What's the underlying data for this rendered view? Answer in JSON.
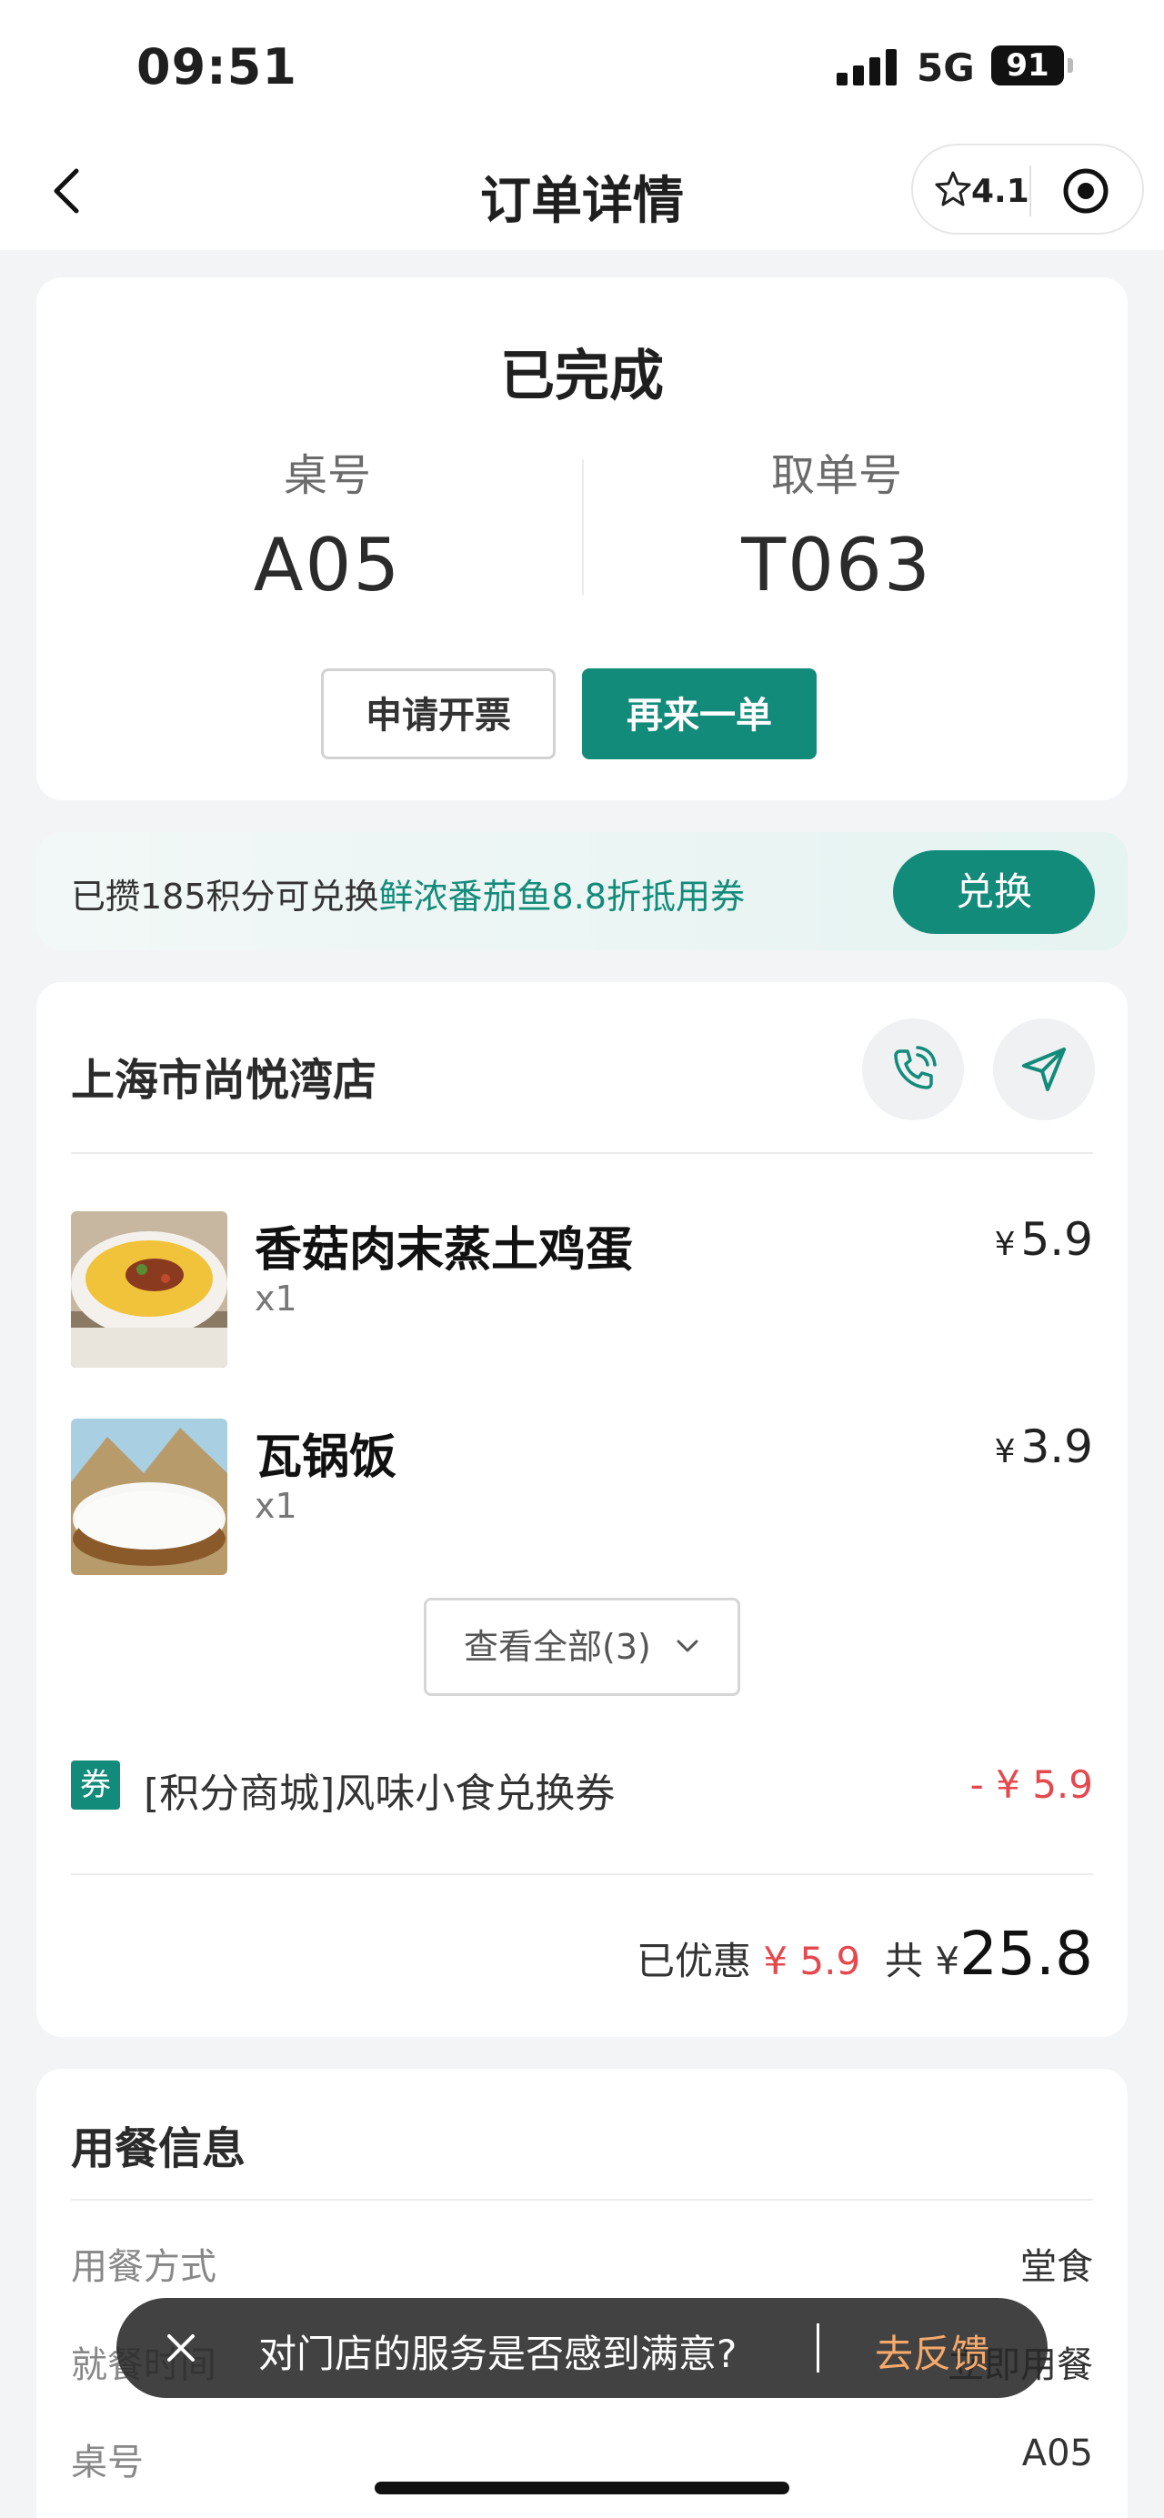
{
  "status_bar": {
    "time": "09:51",
    "network": "5G",
    "battery": "91"
  },
  "nav": {
    "title": "订单详情",
    "rating": "4.1"
  },
  "order_status": {
    "title": "已完成",
    "table_label": "桌号",
    "table_value": "A05",
    "pickup_label": "取单号",
    "pickup_value": "T063",
    "invoice_button": "申请开票",
    "reorder_button": "再来一单"
  },
  "points": {
    "text": "已攒185积分可兑换",
    "coupon": "鲜浓番茄鱼8.8折抵用券",
    "button": "兑换"
  },
  "store": {
    "name": "上海市尚悦湾店"
  },
  "items": [
    {
      "name": "香菇肉末蒸土鸡蛋",
      "qty": "x1",
      "currency": "¥",
      "price": "5.9"
    },
    {
      "name": "瓦锅饭",
      "qty": "x1",
      "currency": "¥",
      "price": "3.9"
    }
  ],
  "view_all": "查看全部(3)",
  "coupon": {
    "tag": "券",
    "name": "[积分商城]风味小食兑换券",
    "amount": "- ¥ 5.9"
  },
  "totals": {
    "discount_label": "已优惠",
    "discount_value": "¥ 5.9",
    "total_label": "共",
    "currency": "¥",
    "total_value": "25.8"
  },
  "dining": {
    "title": "用餐信息",
    "rows": [
      {
        "key": "用餐方式",
        "value": "堂食"
      },
      {
        "key": "就餐时间",
        "value": "立即用餐"
      },
      {
        "key": "桌号",
        "value": "A05"
      }
    ]
  },
  "toast": {
    "message": "对门店的服务是否感到满意?",
    "action": "去反馈"
  },
  "colors": {
    "brand": "#138b7a",
    "discount": "#e5484d",
    "toast_action": "#f6a96b"
  }
}
